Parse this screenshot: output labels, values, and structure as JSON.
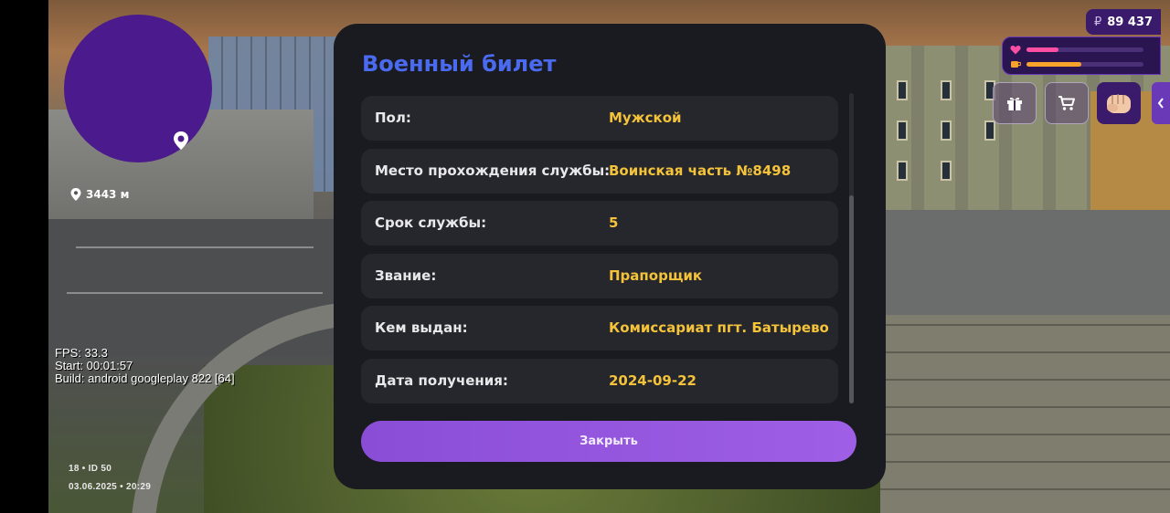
{
  "hud": {
    "money": {
      "currency_symbol": "₽",
      "amount": "89 437"
    },
    "health_level": 0.27,
    "hunger_level": 0.47,
    "colors": {
      "health": "#ff4fa3",
      "hunger": "#f7a32b",
      "accent": "#6a39b8"
    },
    "buttons": [
      "gift-icon",
      "cart-icon",
      "fist-icon",
      "chevron-left-icon"
    ]
  },
  "minimap": {
    "distance": "3443 м"
  },
  "debug": {
    "fps": "FPS: 33.3",
    "start": "Start: 00:01:57",
    "build": "Build: android googleplay 822 [64]"
  },
  "footer": {
    "id_line": "18 • ID 50",
    "datetime": "03.06.2025 • 20:29"
  },
  "modal": {
    "title": "Военный билет",
    "rows": [
      {
        "label": "Пол:",
        "value": "Мужской"
      },
      {
        "label": "Место прохождения службы:",
        "value": "Воинская часть №8498"
      },
      {
        "label": "Срок службы:",
        "value": "5"
      },
      {
        "label": "Звание:",
        "value": "Прапорщик"
      },
      {
        "label": "Кем выдан:",
        "value": "Комиссариат пгт. Батырево"
      },
      {
        "label": "Дата получения:",
        "value": "2024-09-22"
      }
    ],
    "close_label": "Закрыть"
  }
}
